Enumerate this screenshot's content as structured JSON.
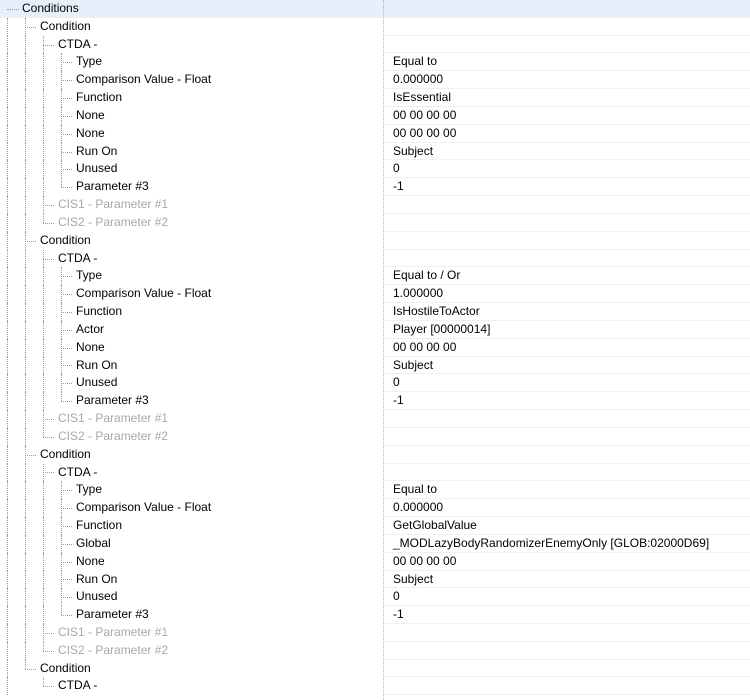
{
  "tree": [
    {
      "level": 0,
      "label": "Conditions",
      "value": ""
    },
    {
      "level": 1,
      "label": "Condition",
      "value": ""
    },
    {
      "level": 2,
      "label": "CTDA -",
      "value": ""
    },
    {
      "level": 3,
      "label": "Type",
      "value": "Equal to"
    },
    {
      "level": 3,
      "label": "Comparison Value - Float",
      "value": "0.000000"
    },
    {
      "level": 3,
      "label": "Function",
      "value": "IsEssential"
    },
    {
      "level": 3,
      "label": "None",
      "value": "00 00 00 00"
    },
    {
      "level": 3,
      "label": "None",
      "value": "00 00 00 00"
    },
    {
      "level": 3,
      "label": "Run On",
      "value": "Subject"
    },
    {
      "level": 3,
      "label": "Unused",
      "value": "0"
    },
    {
      "level": 3,
      "label": "Parameter #3",
      "value": "-1"
    },
    {
      "level": 2,
      "label": "CIS1 - Parameter #1",
      "value": "",
      "disabled": true
    },
    {
      "level": 2,
      "label": "CIS2 - Parameter #2",
      "value": "",
      "disabled": true
    },
    {
      "level": 1,
      "label": "Condition",
      "value": ""
    },
    {
      "level": 2,
      "label": "CTDA -",
      "value": ""
    },
    {
      "level": 3,
      "label": "Type",
      "value": "Equal to / Or"
    },
    {
      "level": 3,
      "label": "Comparison Value - Float",
      "value": "1.000000"
    },
    {
      "level": 3,
      "label": "Function",
      "value": "IsHostileToActor"
    },
    {
      "level": 3,
      "label": "Actor",
      "value": "Player [00000014]"
    },
    {
      "level": 3,
      "label": "None",
      "value": "00 00 00 00"
    },
    {
      "level": 3,
      "label": "Run On",
      "value": "Subject"
    },
    {
      "level": 3,
      "label": "Unused",
      "value": "0"
    },
    {
      "level": 3,
      "label": "Parameter #3",
      "value": "-1"
    },
    {
      "level": 2,
      "label": "CIS1 - Parameter #1",
      "value": "",
      "disabled": true
    },
    {
      "level": 2,
      "label": "CIS2 - Parameter #2",
      "value": "",
      "disabled": true
    },
    {
      "level": 1,
      "label": "Condition",
      "value": ""
    },
    {
      "level": 2,
      "label": "CTDA -",
      "value": ""
    },
    {
      "level": 3,
      "label": "Type",
      "value": "Equal to"
    },
    {
      "level": 3,
      "label": "Comparison Value - Float",
      "value": "0.000000"
    },
    {
      "level": 3,
      "label": "Function",
      "value": "GetGlobalValue"
    },
    {
      "level": 3,
      "label": "Global",
      "value": "_MODLazyBodyRandomizerEnemyOnly [GLOB:02000D69]"
    },
    {
      "level": 3,
      "label": "None",
      "value": "00 00 00 00"
    },
    {
      "level": 3,
      "label": "Run On",
      "value": "Subject"
    },
    {
      "level": 3,
      "label": "Unused",
      "value": "0"
    },
    {
      "level": 3,
      "label": "Parameter #3",
      "value": "-1"
    },
    {
      "level": 2,
      "label": "CIS1 - Parameter #1",
      "value": "",
      "disabled": true
    },
    {
      "level": 2,
      "label": "CIS2 - Parameter #2",
      "value": "",
      "disabled": true
    },
    {
      "level": 1,
      "label": "Condition",
      "value": ""
    },
    {
      "level": 2,
      "label": "CTDA -",
      "value": ""
    }
  ]
}
